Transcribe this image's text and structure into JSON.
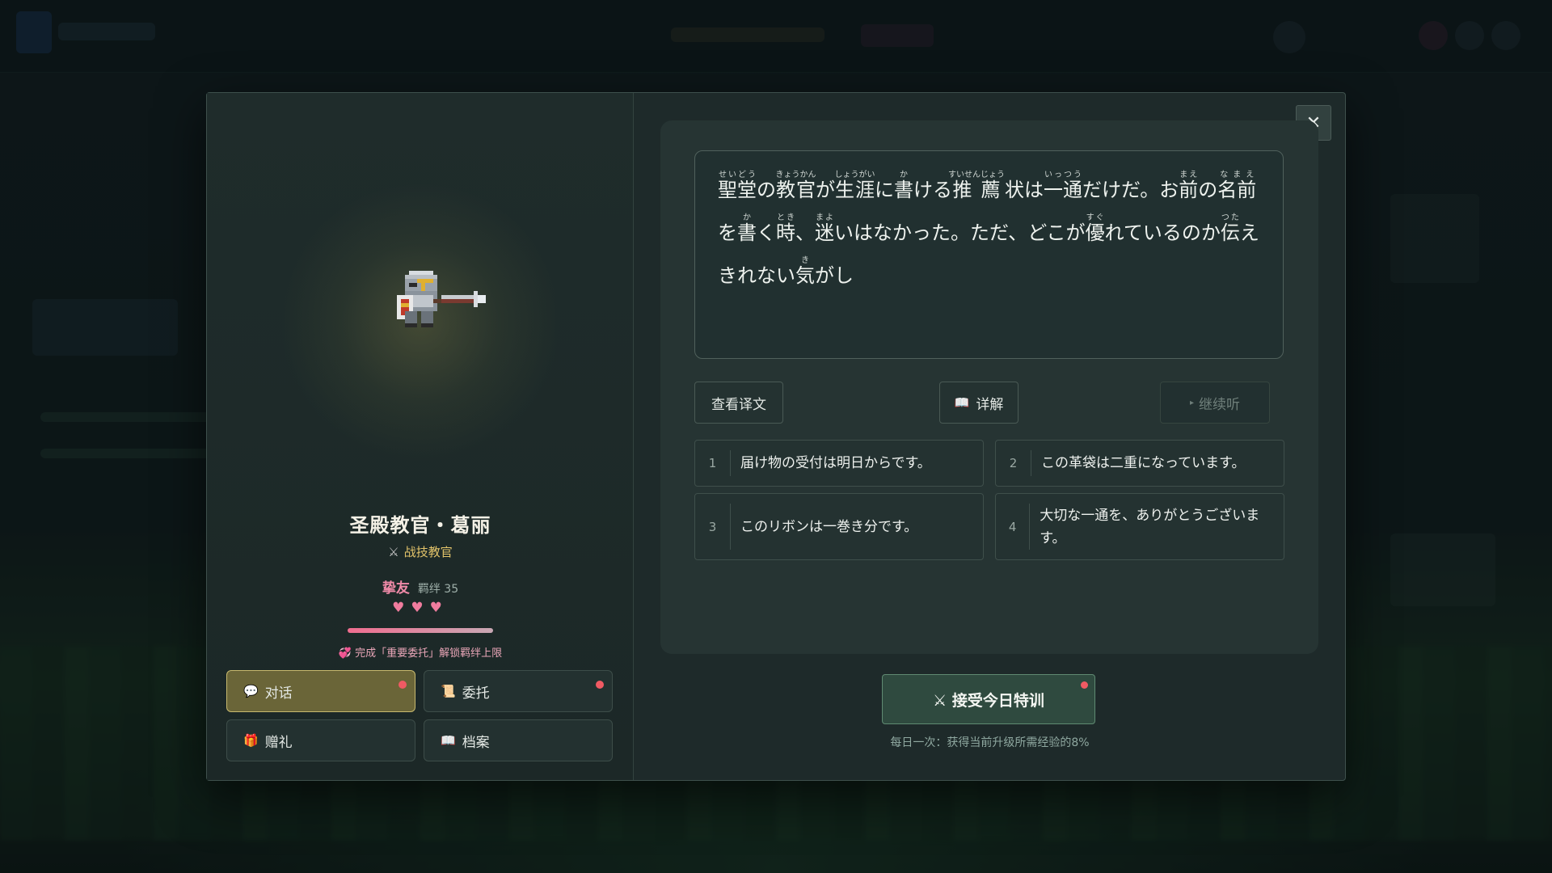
{
  "character": {
    "name": "圣殿教官・葛丽",
    "role": "战技教官",
    "role_icon": "crossed-swords-icon",
    "bond_level": "挚友",
    "bond_points": "羁绊 35",
    "hearts": "♥♥♥",
    "bond_progress": 1.0,
    "unlock_hint": "💞 完成「重要委托」解锁羁绊上限"
  },
  "tabs": [
    {
      "label": "对话",
      "icon": "💬",
      "active": true,
      "notify": true
    },
    {
      "label": "委托",
      "icon": "📜",
      "active": false,
      "notify": true
    },
    {
      "label": "赠礼",
      "icon": "🎁",
      "active": false,
      "notify": false
    },
    {
      "label": "档案",
      "icon": "📖",
      "active": false,
      "notify": false
    }
  ],
  "dialogue": {
    "segments": [
      {
        "base": "聖堂",
        "rt": "せいどう"
      },
      {
        "text": "の"
      },
      {
        "base": "教官",
        "rt": "きょうかん"
      },
      {
        "text": "が"
      },
      {
        "base": "生涯",
        "rt": "しょうがい"
      },
      {
        "text": "に"
      },
      {
        "base": "書",
        "rt": "か"
      },
      {
        "text": "ける"
      },
      {
        "base": "推薦",
        "rt": "すいせんじょう"
      },
      {
        "base": "状",
        "rt": ""
      },
      {
        "text": "は"
      },
      {
        "base": "一通",
        "rt": "いっつう"
      },
      {
        "text": "だけだ。お"
      },
      {
        "base": "前",
        "rt": "まえ"
      },
      {
        "text": "の"
      },
      {
        "base": "名前",
        "rt": "なまえ"
      },
      {
        "text": "を"
      },
      {
        "base": "書",
        "rt": "か"
      },
      {
        "text": "く"
      },
      {
        "base": "時",
        "rt": "とき"
      },
      {
        "text": "、"
      },
      {
        "base": "迷",
        "rt": "まよ"
      },
      {
        "text": "いはなかった。ただ、どこが"
      },
      {
        "base": "優",
        "rt": "すぐ"
      },
      {
        "text": "れているのか"
      },
      {
        "base": "伝",
        "rt": "つた"
      },
      {
        "text": "えきれない"
      },
      {
        "base": "気",
        "rt": "き"
      },
      {
        "text": "がし"
      }
    ]
  },
  "actions": {
    "translate": "查看译文",
    "detail": "详解",
    "detail_icon": "book-icon",
    "continue": "继续听"
  },
  "options": [
    {
      "num": "1",
      "text": "届け物の受付は明日からです。"
    },
    {
      "num": "2",
      "text": "この革袋は二重になっています。"
    },
    {
      "num": "3",
      "text": "このリボンは一巻き分です。"
    },
    {
      "num": "4",
      "text": "大切な一通を、ありがとうございます。"
    }
  ],
  "training": {
    "label": "⚔ 接受今日特训",
    "note": "每日一次：获得当前升级所需经验的8%"
  },
  "close_icon": "close-icon"
}
